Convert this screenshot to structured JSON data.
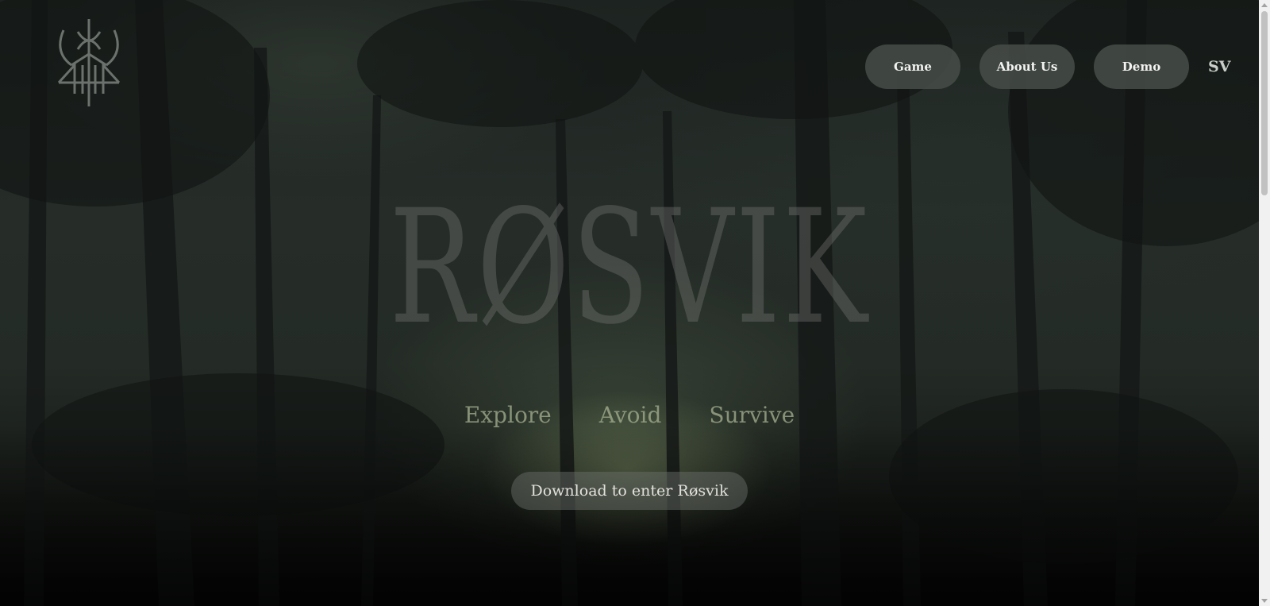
{
  "header": {
    "logo_icon": "runic-logo-icon",
    "nav": [
      {
        "label": "Game"
      },
      {
        "label": "About Us"
      },
      {
        "label": "Demo"
      }
    ],
    "language": "SV"
  },
  "hero": {
    "title": "RØSVIK",
    "taglines": [
      "Explore",
      "Avoid",
      "Survive"
    ],
    "cta_label": "Download to enter Røsvik"
  },
  "colors": {
    "nav_button_bg": "#464c48",
    "title": "#7a7c78",
    "tagline": "#a0aa8c"
  }
}
